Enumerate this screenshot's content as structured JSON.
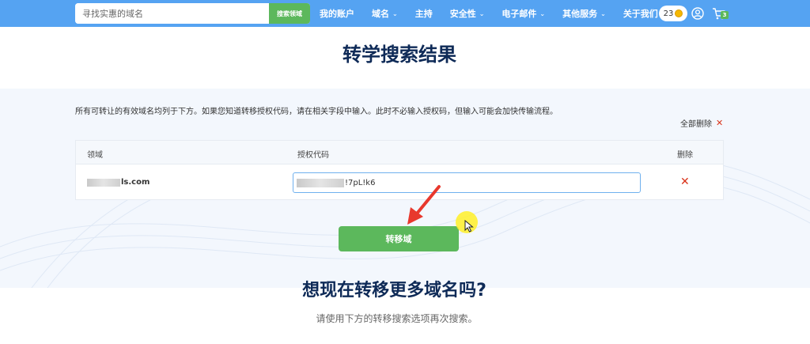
{
  "header": {
    "search": {
      "placeholder": "寻找实惠的域名",
      "button_label": "搜索领域"
    },
    "nav": [
      {
        "label": "我的账户",
        "has_dropdown": false
      },
      {
        "label": "域名",
        "has_dropdown": true
      },
      {
        "label": "主持",
        "has_dropdown": false
      },
      {
        "label": "安全性",
        "has_dropdown": true
      },
      {
        "label": "电子邮件",
        "has_dropdown": true
      },
      {
        "label": "其他服务",
        "has_dropdown": true
      },
      {
        "label": "关于我们",
        "has_dropdown": false
      }
    ],
    "credits": "23",
    "cart_count": "3",
    "icons": [
      "coin-icon",
      "user-icon",
      "cart-icon"
    ]
  },
  "page": {
    "title": "转学搜索结果",
    "intro": "所有可转让的有效域名均列于下方。如果您知道转移授权代码，请在相关字段中输入。此时不必输入授权码，但输入可能会加快传输流程。",
    "remove_all_label": "全部删除"
  },
  "table": {
    "headers": {
      "domain": "领域",
      "auth_code": "授权代码",
      "delete": "删除"
    },
    "rows": [
      {
        "domain_visible": "ls.com",
        "auth_code_visible": "!7pL!k6"
      }
    ]
  },
  "transfer_button": "转移域",
  "more": {
    "title": "想现在转移更多域名吗?",
    "subtitle": "请使用下方的转移搜索选项再次搜索。"
  },
  "colors": {
    "topbar": "#55a3f2",
    "accent_green": "#5cb85c",
    "title_navy": "#0e2a57",
    "delete_red": "#d9331a",
    "annotation_arrow": "#e8382d",
    "cursor_highlight": "#fff028"
  }
}
